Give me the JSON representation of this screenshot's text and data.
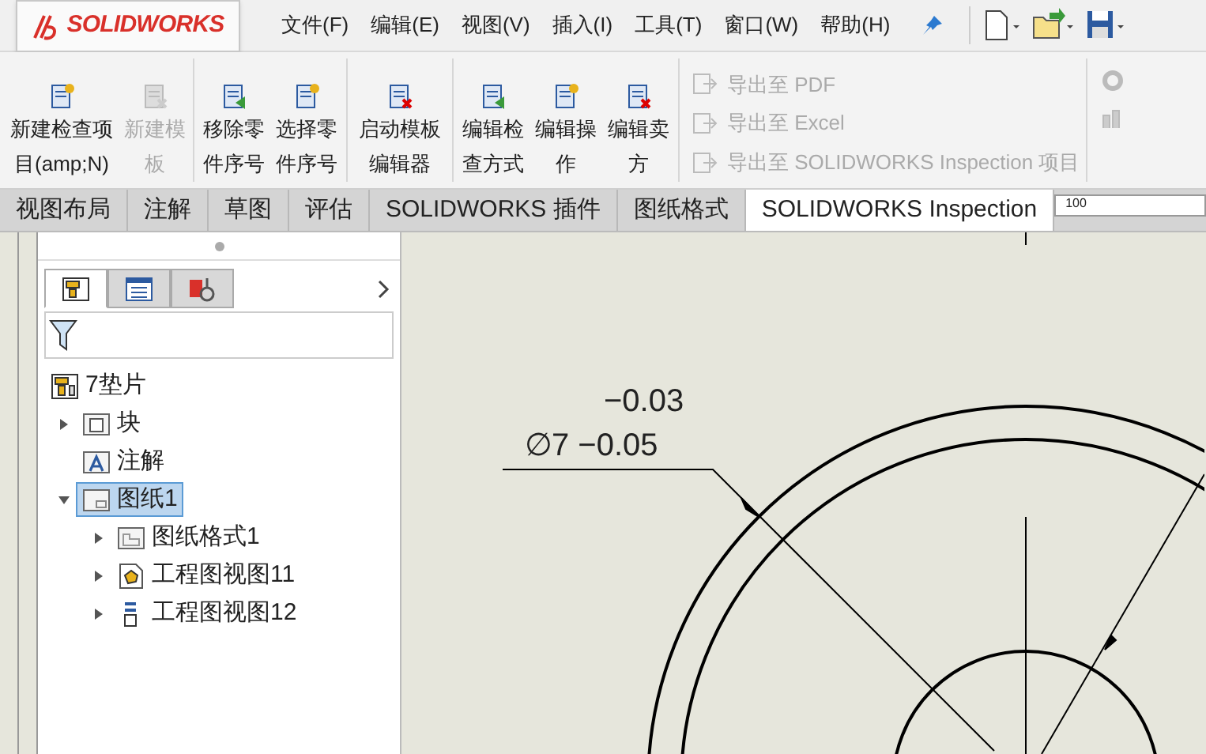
{
  "app": {
    "logo": "SOLIDWORKS"
  },
  "menu": [
    "文件(F)",
    "编辑(E)",
    "视图(V)",
    "插入(I)",
    "工具(T)",
    "窗口(W)",
    "帮助(H)"
  ],
  "ribbon": {
    "groups": [
      {
        "buttons": [
          {
            "label": "新建检查项目(amp;N)",
            "disabled": false
          },
          {
            "label": "新建模板",
            "disabled": true
          }
        ]
      },
      {
        "buttons": [
          {
            "label": "移除零件序号",
            "disabled": false
          },
          {
            "label": "选择零件序号",
            "disabled": false
          }
        ]
      },
      {
        "buttons": [
          {
            "label": "启动模板编辑器",
            "disabled": false
          }
        ]
      },
      {
        "buttons": [
          {
            "label": "编辑检查方式",
            "disabled": false
          },
          {
            "label": "编辑操作",
            "disabled": false
          },
          {
            "label": "编辑卖方",
            "disabled": false
          }
        ]
      }
    ],
    "exports": [
      {
        "label": "导出至 PDF",
        "disabled": true
      },
      {
        "label": "导出至 Excel",
        "disabled": true
      },
      {
        "label": "导出至 SOLIDWORKS Inspection 项目",
        "disabled": true
      }
    ]
  },
  "tabs": [
    {
      "label": "视图布局",
      "selected": false
    },
    {
      "label": "注解",
      "selected": false
    },
    {
      "label": "草图",
      "selected": false
    },
    {
      "label": "评估",
      "selected": false
    },
    {
      "label": "SOLIDWORKS 插件",
      "selected": false
    },
    {
      "label": "图纸格式",
      "selected": false
    },
    {
      "label": "SOLIDWORKS Inspection",
      "selected": true
    }
  ],
  "ruler": {
    "label": "100"
  },
  "panel": {
    "tabs": [
      {
        "kind": "tree",
        "selected": true
      },
      {
        "kind": "properties",
        "selected": false
      },
      {
        "kind": "inspection",
        "selected": false
      }
    ],
    "tree": {
      "label": "7垫片",
      "kind": "drawing",
      "children": [
        {
          "label": "块",
          "kind": "blocks",
          "expanded": false
        },
        {
          "label": "注解",
          "kind": "annotations"
        },
        {
          "label": "图纸1",
          "kind": "sheet",
          "expanded": true,
          "selected": true,
          "children": [
            {
              "label": "图纸格式1",
              "kind": "format",
              "expanded": false
            },
            {
              "label": "工程图视图11",
              "kind": "part-view",
              "expanded": false
            },
            {
              "label": "工程图视图12",
              "kind": "view",
              "expanded": false
            }
          ]
        }
      ]
    }
  },
  "canvas": {
    "tolerance_upper": "−0.03",
    "dimension": "∅7 −0.05"
  }
}
